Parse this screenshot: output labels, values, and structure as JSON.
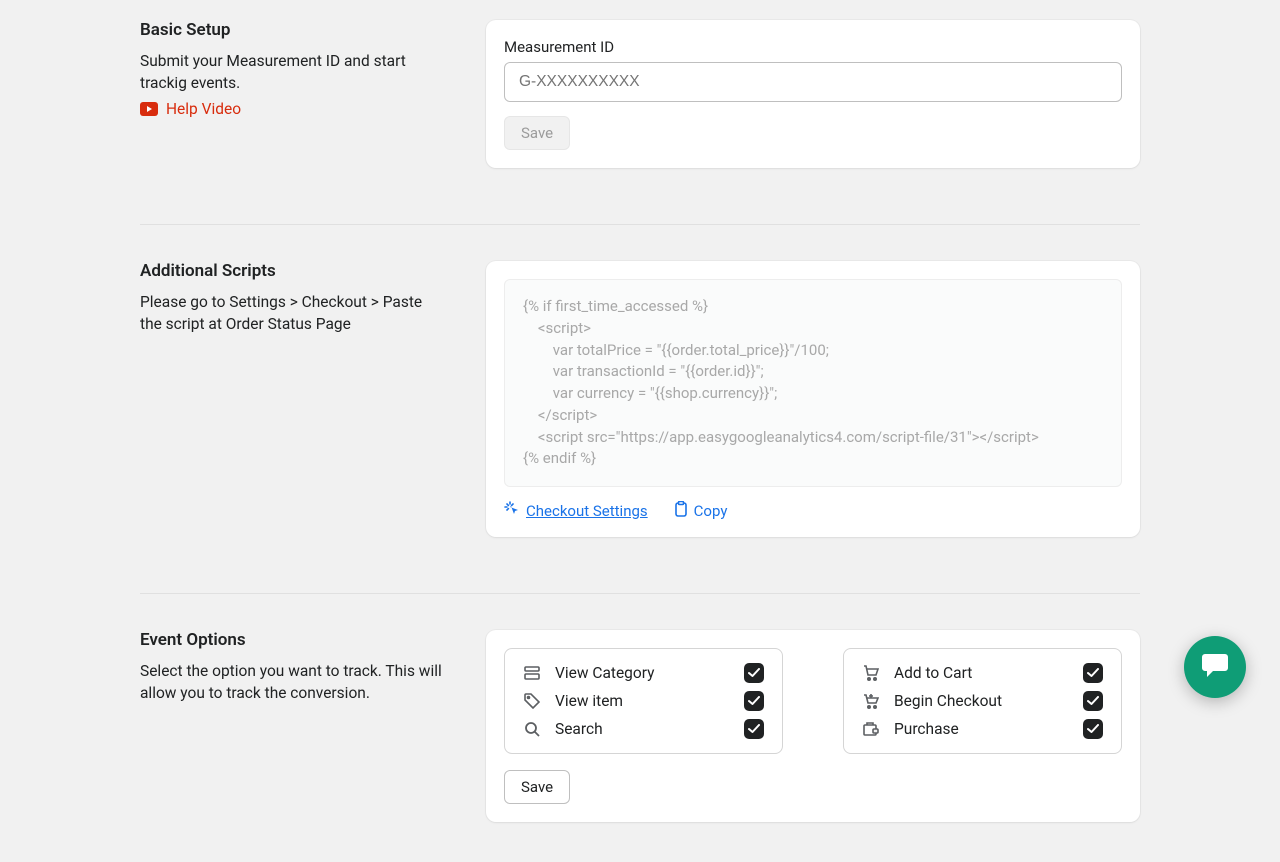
{
  "sections": {
    "basic": {
      "title": "Basic Setup",
      "desc": "Submit your Measurement ID and start trackig events.",
      "help_label": "Help Video",
      "field_label": "Measurement ID",
      "placeholder": "G-XXXXXXXXXX",
      "value": "",
      "save_label": "Save"
    },
    "scripts": {
      "title": "Additional Scripts",
      "desc": "Please go to Settings > Checkout > Paste the script at Order Status Page",
      "code": "{% if first_time_accessed %}\n    <script>\n        var totalPrice = \"{{order.total_price}}\"/100;\n        var transactionId = \"{{order.id}}\";\n        var currency = \"{{shop.currency}}\";\n    </script>\n    <script src=\"https://app.easygoogleanalytics4.com/script-file/31\"></script>\n{% endif %}",
      "checkout_label": "Checkout Settings",
      "copy_label": "Copy"
    },
    "events": {
      "title": "Event Options",
      "desc": "Select the option you want to track. This will allow you to track the conversion.",
      "left": [
        {
          "label": "View Category"
        },
        {
          "label": "View item"
        },
        {
          "label": "Search"
        }
      ],
      "right": [
        {
          "label": "Add to Cart"
        },
        {
          "label": "Begin Checkout"
        },
        {
          "label": "Purchase"
        }
      ],
      "save_label": "Save"
    }
  }
}
